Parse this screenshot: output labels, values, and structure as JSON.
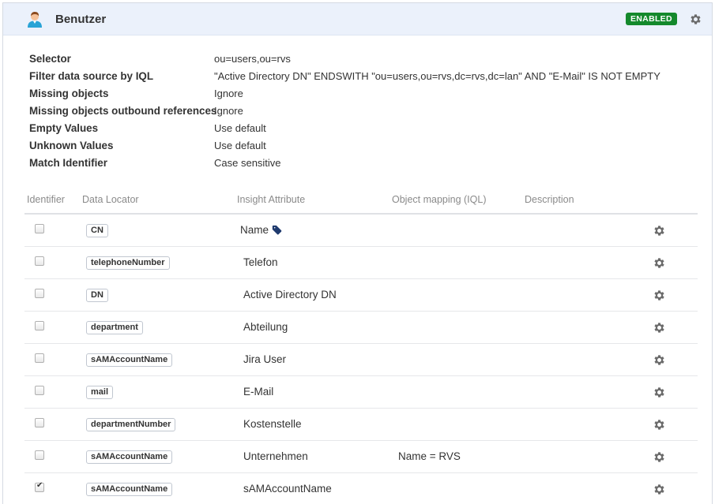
{
  "header": {
    "title": "Benutzer",
    "status": "ENABLED",
    "status_color": "#14892c",
    "avatar_icon": "user-avatar-icon",
    "settings_icon": "gear-icon"
  },
  "properties": [
    {
      "label": "Selector",
      "value": "ou=users,ou=rvs"
    },
    {
      "label": "Filter data source by IQL",
      "value": "\"Active Directory DN\" ENDSWITH \"ou=users,ou=rvs,dc=rvs,dc=lan\" AND \"E-Mail\" IS NOT EMPTY"
    },
    {
      "label": "Missing objects",
      "value": "Ignore"
    },
    {
      "label": "Missing objects outbound references",
      "value": "Ignore"
    },
    {
      "label": "Empty Values",
      "value": "Use default"
    },
    {
      "label": "Unknown Values",
      "value": "Use default"
    },
    {
      "label": "Match Identifier",
      "value": "Case sensitive"
    }
  ],
  "table": {
    "columns": [
      "Identifier",
      "Data Locator",
      "Insight Attribute",
      "Object mapping (IQL)",
      "Description"
    ],
    "rows": [
      {
        "identifier": false,
        "locator": "CN",
        "attribute": "Name",
        "label_tag": true,
        "mapping": "",
        "description": ""
      },
      {
        "identifier": false,
        "locator": "telephoneNumber",
        "attribute": "Telefon",
        "mapping": "",
        "description": ""
      },
      {
        "identifier": false,
        "locator": "DN",
        "attribute": "Active Directory DN",
        "mapping": "",
        "description": ""
      },
      {
        "identifier": false,
        "locator": "department",
        "attribute": "Abteilung",
        "mapping": "",
        "description": ""
      },
      {
        "identifier": false,
        "locator": "sAMAccountName",
        "attribute": "Jira User",
        "mapping": "",
        "description": ""
      },
      {
        "identifier": false,
        "locator": "mail",
        "attribute": "E-Mail",
        "mapping": "",
        "description": ""
      },
      {
        "identifier": false,
        "locator": "departmentNumber",
        "attribute": "Kostenstelle",
        "mapping": "",
        "description": ""
      },
      {
        "identifier": false,
        "locator": "sAMAccountName",
        "attribute": "Unternehmen",
        "mapping": "Name = RVS",
        "description": ""
      },
      {
        "identifier": true,
        "locator": "sAMAccountName",
        "attribute": "sAMAccountName",
        "mapping": "",
        "description": ""
      }
    ]
  }
}
